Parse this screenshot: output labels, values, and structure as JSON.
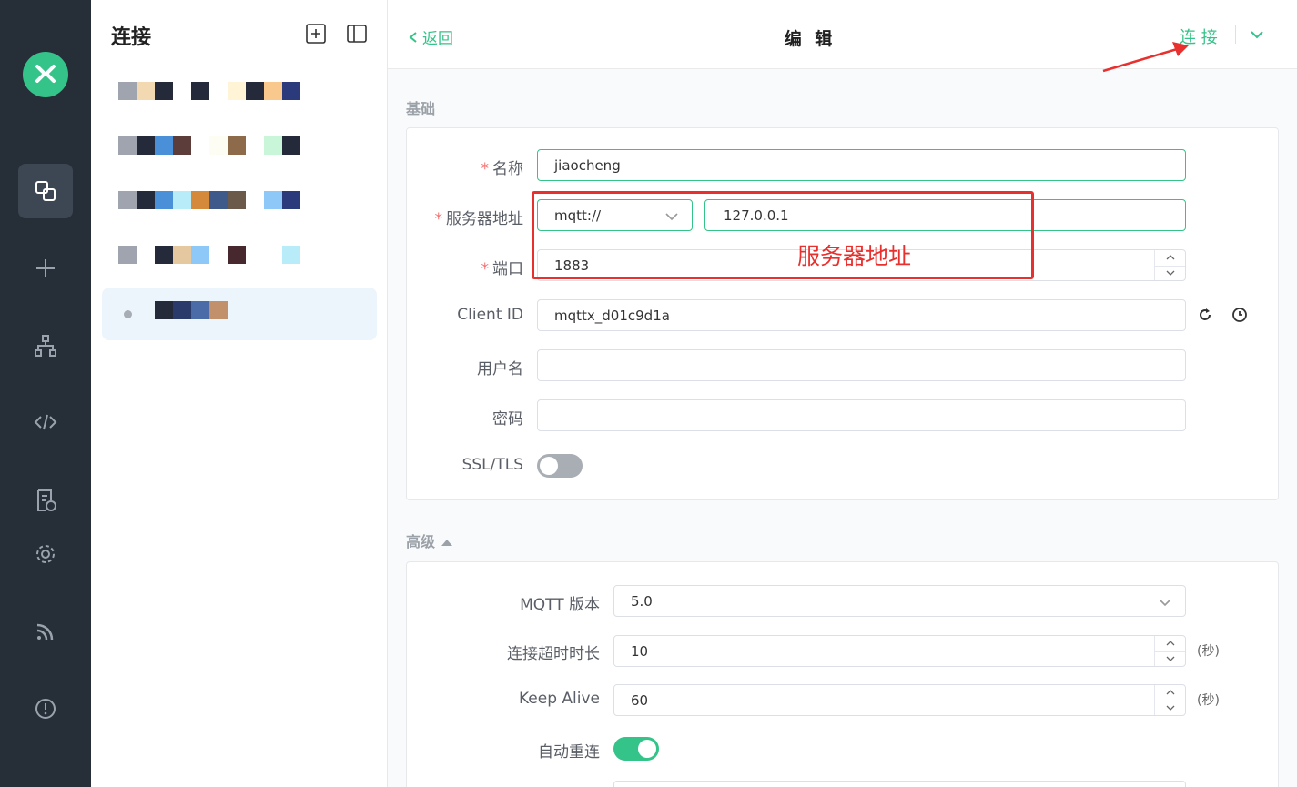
{
  "rail": {
    "logo": "mqttx-logo",
    "items": [
      "connections-icon",
      "plus-icon",
      "topology-icon",
      "code-icon",
      "log-icon",
      "gear-icon",
      "feed-icon",
      "info-icon"
    ]
  },
  "sidebar": {
    "title": "连接",
    "connections": [
      {
        "colors": [
          "#a0a4ae",
          "#f3d9b1",
          "#252a3a",
          "#ffffff",
          "#252a3a",
          "#ffffff",
          "#fff5d6",
          "#252a3a",
          "#f9c88c",
          "#2a3a7a"
        ]
      },
      {
        "colors": [
          "#a0a4ae",
          "#252a3a",
          "#4a90d9",
          "#5c3d3a",
          "#ffffff",
          "#fdfdf3",
          "#8d6a4a",
          "#ffffff",
          "#c9f5d8",
          "#252a3a"
        ]
      },
      {
        "colors": [
          "#a0a4ae",
          "#252a3a",
          "#4a90d9",
          "#b8ecf8",
          "#d48a3a",
          "#3d5a8a",
          "#6b5a4a",
          "#ffffff",
          "#8ec8f8",
          "#2a3a7a"
        ]
      },
      {
        "colors": [
          "#a0a4ae",
          "#ffffff",
          "#252a3a",
          "#e6c8a0",
          "#8ec8f8",
          "#ffffff",
          "#47282e",
          "#ffffff",
          "#ffffff",
          "#b8ecf8"
        ]
      },
      {
        "colors": [
          "#252a3a",
          "#2a3a6a",
          "#4a6aa8",
          "#c2906a"
        ]
      }
    ]
  },
  "header": {
    "back_label": "返回",
    "title": "编 辑",
    "connect_label": "连 接"
  },
  "basic": {
    "section_title": "基础",
    "name_label": "名称",
    "name_value": "jiaocheng",
    "host_label": "服务器地址",
    "protocol_value": "mqtt://",
    "host_value": "127.0.0.1",
    "port_label": "端口",
    "port_value": "1883",
    "client_id_label": "Client ID",
    "client_id_value": "mqttx_d01c9d1a",
    "username_label": "用户名",
    "password_label": "密码",
    "ssl_label": "SSL/TLS",
    "ssl_enabled": false
  },
  "advanced": {
    "section_title": "高级",
    "mqtt_version_label": "MQTT 版本",
    "mqtt_version_value": "5.0",
    "timeout_label": "连接超时时长",
    "timeout_value": "10",
    "timeout_unit": "(秒)",
    "keepalive_label": "Keep Alive",
    "keepalive_value": "60",
    "keepalive_unit": "(秒)",
    "reconnect_label": "自动重连",
    "reconnect_enabled": true
  },
  "annotation": {
    "text": "服务器地址",
    "color": "#e8302e"
  },
  "colors": {
    "accent": "#34c388",
    "rail_bg": "#262e38",
    "required": "#f56c6c"
  }
}
